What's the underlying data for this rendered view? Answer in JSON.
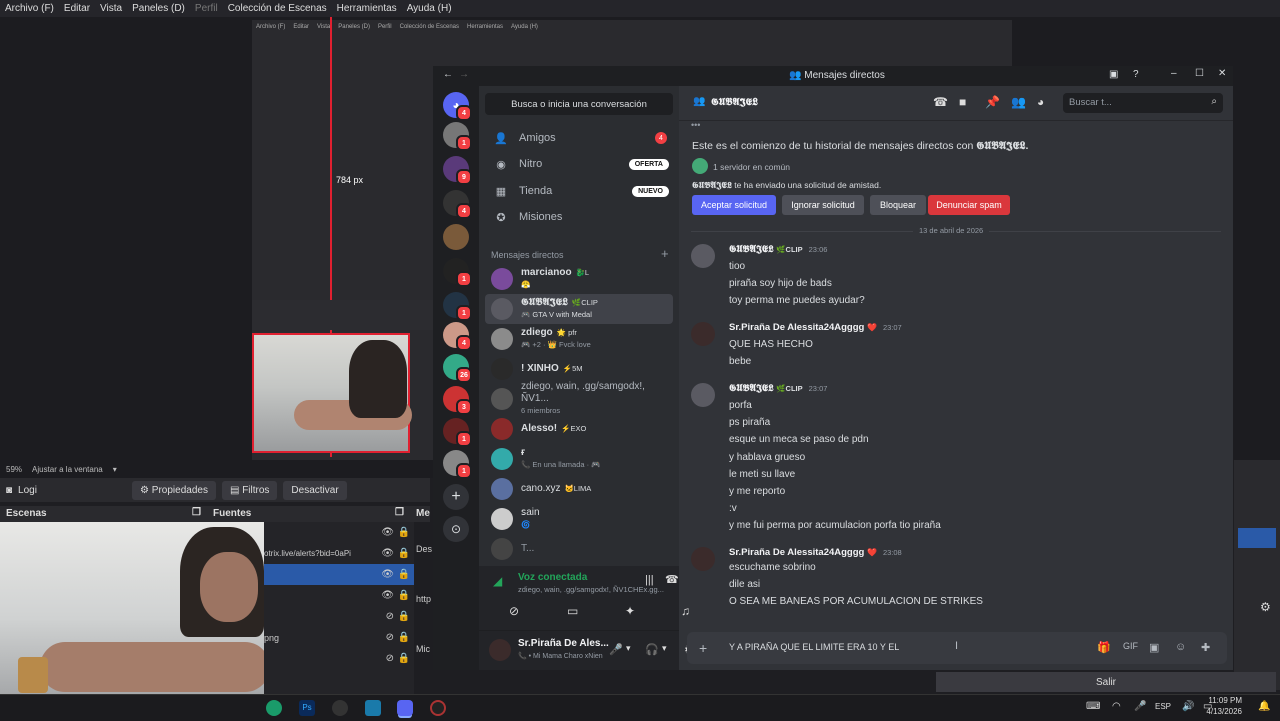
{
  "obs": {
    "menu": [
      "Archivo (F)",
      "Editar",
      "Vista",
      "Paneles (D)",
      "Perfil",
      "Colección de Escenas",
      "Herramientas",
      "Ayuda (H)"
    ],
    "nested_menu": [
      "Archivo (F)",
      "Editar",
      "Vista",
      "Paneles (D)",
      "Perfil",
      "Colección de Escenas",
      "Herramientas",
      "Ayuda (H)"
    ],
    "canvas_label": "784 px",
    "zoom": "59%",
    "zoom_mode": "Ajustar a la ventana",
    "source_name": "Logi",
    "btn_properties": "Propiedades",
    "btn_filters": "Filtros",
    "btn_disable": "Desactivar",
    "scenes_title": "Escenas",
    "sources_title": "Fuentes",
    "sources": [
      "",
      "otrix.live/alerts?bid=0aPi",
      "",
      "",
      "",
      "png",
      ""
    ],
    "salir": "Salir",
    "mixer_short": "Me",
    "side_labels": [
      "Des",
      "http",
      "Mic"
    ]
  },
  "discord": {
    "window_title": "Mensajes directos",
    "search_conv": "Busca o inicia una conversación",
    "nav": [
      {
        "icon": "friends-icon",
        "label": "Amigos",
        "badge": "4"
      },
      {
        "icon": "nitro-icon",
        "label": "Nitro",
        "pill": "OFERTA"
      },
      {
        "icon": "shop-icon",
        "label": "Tienda",
        "pill": "NUEVO"
      },
      {
        "icon": "missions-icon",
        "label": "Misiones"
      }
    ],
    "dm_section": "Mensajes directos",
    "dms": [
      {
        "name": "marcianoo",
        "tag": "🐉L",
        "sub": "😤",
        "color": "#7a4b9c"
      },
      {
        "name": "𝕲𝖀𝕭𝕬𝕵𝕰𝕷",
        "tag": "🌿CLIP",
        "sub": "🎮 GTA V with Medal",
        "color": "#5a5a62",
        "active": true
      },
      {
        "name": "zdiego",
        "tag": "🌟 pfr",
        "sub": "🎮 +2 · 👑 Fvck love",
        "color": "#8b8b8b"
      },
      {
        "name": "! XINHO",
        "tag": "⚡5M",
        "sub": "",
        "color": "#2a2a2a"
      },
      {
        "name": "zdiego, wain, .gg/samgodx!, ÑV1...",
        "tag": "",
        "sub": "6 miembros",
        "color": "#555"
      },
      {
        "name": "Alesso!",
        "tag": "⚡EXO",
        "sub": "",
        "color": "#8a2a2a"
      },
      {
        "name": "ғ",
        "tag": "",
        "sub": "📞 En una llamada · 🎮",
        "color": "#3aa"
      },
      {
        "name": "cano.xyz",
        "tag": "🐱LIMA",
        "sub": "",
        "color": "#5a6fa0"
      },
      {
        "name": "ꜱain",
        "tag": "",
        "sub": "🌀",
        "color": "#ccc"
      },
      {
        "name": "T...",
        "tag": "",
        "sub": "",
        "color": "#444"
      }
    ],
    "voice_status": "Voz conectada",
    "voice_channel": "zdiego, wain, .gg/samgodx!, ÑV1CHEx.gg...",
    "user_name": "Sr.Piraña De Ales...",
    "user_status": "📞 • Mi Mama Charo xNien",
    "chat_name": "𝕲𝖀𝕭𝕬𝕵𝕰𝕷",
    "search_placeholder": "Buscar t...",
    "intro_text": "Este es el comienzo de tu historial de mensajes directos con",
    "intro_name": "𝕲𝖀𝕭𝕬𝕵𝕰𝕷.",
    "mutual": "1 servidor en común",
    "request_name": "𝕲𝖀𝕭𝕬𝕵𝕰𝕷",
    "request_text": "te ha enviado una solicitud de amistad.",
    "btn_accept": "Aceptar solicitud",
    "btn_ignore": "Ignorar solicitud",
    "btn_block": "Bloquear",
    "btn_report": "Denunciar spam",
    "date_divider": "13 de abril de 2026",
    "messages": [
      {
        "author": "𝕲𝖀𝕭𝕬𝕵𝕰𝕷",
        "tag": "🌿CLIP",
        "time": "23:06",
        "lines": [
          "tioo",
          "piraña soy hijo de bads",
          "toy perma me puedes ayudar?"
        ]
      },
      {
        "author": "Sr.Piraña De Alessita24Agggg",
        "tag": "❤️",
        "time": "23:07",
        "lines": [
          "QUE HAS HECHO",
          "bebe"
        ]
      },
      {
        "author": "𝕲𝖀𝕭𝕬𝕵𝕰𝕷",
        "tag": "🌿CLIP",
        "time": "23:07",
        "lines": [
          "porfa",
          "ps piraña",
          "esque un meca se paso de pdn",
          "y hablava grueso",
          "le meti su llave",
          "y me reporto",
          ":v",
          "y me fui perma por acumulacion porfa tio piraña"
        ]
      },
      {
        "author": "Sr.Piraña De Alessita24Agggg",
        "tag": "❤️",
        "time": "23:08",
        "lines": [
          "escuchame sobrino",
          "dile asi",
          "O SEA ME BANEAS POR ACUMULACION DE STRIKES"
        ]
      }
    ],
    "composer_text": "Y A PIRAÑA QUE EL LIMITE ERA 10 Y EL"
  },
  "taskbar": {
    "time": "11:09 PM",
    "date": "4/13/2026",
    "lang": "ESP"
  }
}
